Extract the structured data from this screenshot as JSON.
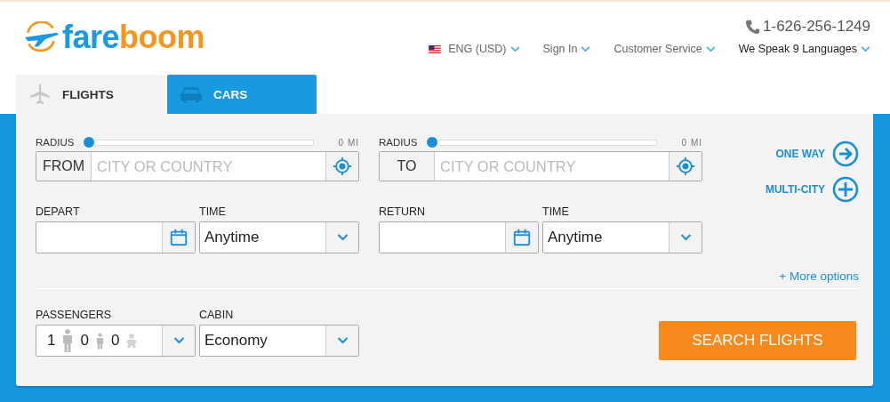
{
  "header": {
    "logo": {
      "part_1": "fare",
      "part_2": "boom"
    },
    "phone": "1-626-256-1249",
    "nav": [
      {
        "kind": "language",
        "label": "ENG (USD)"
      },
      {
        "kind": "menu",
        "label": "Sign In"
      },
      {
        "kind": "menu",
        "label": "Customer Service"
      },
      {
        "kind": "emphasis",
        "label": "We Speak 9 Languages"
      }
    ]
  },
  "tabs": [
    {
      "label": "FLIGHTS",
      "selected": true,
      "kind": "plane"
    },
    {
      "label": "CARS",
      "selected": false,
      "kind": "car"
    }
  ],
  "search_form": {
    "legs": [
      {
        "radius": {
          "label": "RADIUS",
          "level": 0,
          "reading": "0 MI"
        },
        "place": {
          "label": "FROM",
          "placeholder": "CITY OR COUNTRY"
        },
        "date": {
          "label": "DEPART"
        },
        "time": {
          "label": "TIME",
          "value": "Anytime"
        }
      },
      {
        "radius": {
          "label": "RADIUS",
          "level": 0,
          "reading": "0 MI"
        },
        "place": {
          "label": "TO",
          "placeholder": "CITY OR COUNTRY"
        },
        "date": {
          "label": "RETURN"
        },
        "time": {
          "label": "TIME",
          "value": "Anytime"
        }
      }
    ],
    "trip_options": [
      {
        "label": "ONE WAY",
        "kind": "arrow"
      },
      {
        "label": "MULTI-CITY",
        "kind": "plus"
      }
    ],
    "more_options": "+ More options",
    "passengers": {
      "label": "PASSENGERS",
      "counts": [
        {
          "kind": "adult",
          "value": "1"
        },
        {
          "kind": "child",
          "value": "0"
        },
        {
          "kind": "infant",
          "value": "0"
        }
      ]
    },
    "cabin": {
      "label": "CABIN",
      "value": "Economy"
    },
    "search_button": "SEARCH FLIGHTS"
  }
}
